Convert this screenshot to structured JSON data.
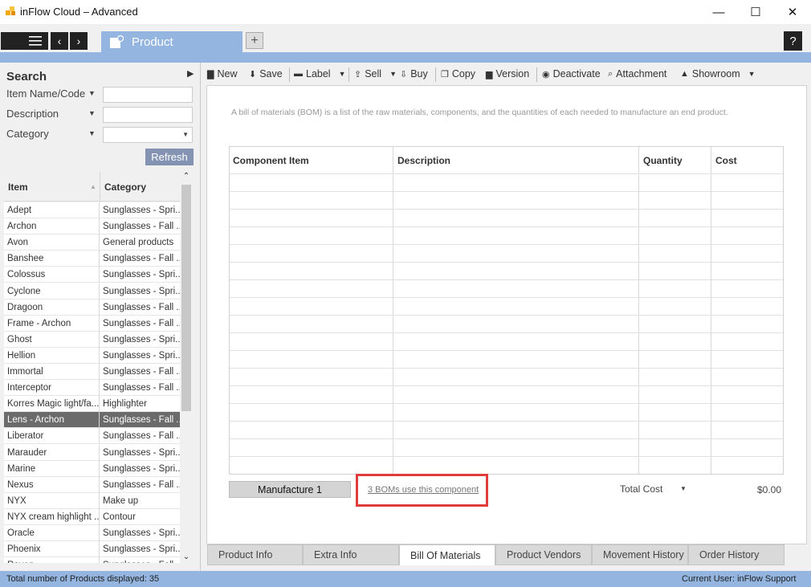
{
  "window": {
    "title": "inFlow Cloud – Advanced",
    "minimize": "—",
    "maximize": "☐",
    "close": "✕"
  },
  "tabs": {
    "product_tab": "Product",
    "add_tab": "+",
    "help": "?"
  },
  "search": {
    "title": "Search",
    "fields": [
      {
        "label": "Item Name/Code",
        "value": ""
      },
      {
        "label": "Description",
        "value": ""
      },
      {
        "label": "Category",
        "value": ""
      }
    ],
    "refresh_label": "Refresh"
  },
  "list": {
    "headers": {
      "item": "Item",
      "category": "Category"
    },
    "rows": [
      {
        "item": "Adept",
        "category": "Sunglasses - Spri..."
      },
      {
        "item": "Archon",
        "category": "Sunglasses - Fall ..."
      },
      {
        "item": "Avon",
        "category": "General products"
      },
      {
        "item": "Banshee",
        "category": "Sunglasses - Fall ..."
      },
      {
        "item": "Colossus",
        "category": "Sunglasses - Spri..."
      },
      {
        "item": "Cyclone",
        "category": "Sunglasses - Spri..."
      },
      {
        "item": "Dragoon",
        "category": "Sunglasses - Fall ..."
      },
      {
        "item": "Frame - Archon",
        "category": "Sunglasses - Fall ..."
      },
      {
        "item": "Ghost",
        "category": "Sunglasses - Spri..."
      },
      {
        "item": "Hellion",
        "category": "Sunglasses - Spri..."
      },
      {
        "item": "Immortal",
        "category": "Sunglasses - Fall ..."
      },
      {
        "item": "Interceptor",
        "category": "Sunglasses - Fall ..."
      },
      {
        "item": "Korres Magic light/fa...",
        "category": "Highlighter"
      },
      {
        "item": "Lens - Archon",
        "category": "Sunglasses - Fall ...",
        "selected": true
      },
      {
        "item": "Liberator",
        "category": "Sunglasses - Fall ..."
      },
      {
        "item": "Marauder",
        "category": "Sunglasses - Spri..."
      },
      {
        "item": "Marine",
        "category": "Sunglasses - Spri..."
      },
      {
        "item": "Nexus",
        "category": "Sunglasses - Fall ..."
      },
      {
        "item": "NYX",
        "category": "Make up"
      },
      {
        "item": "NYX cream highlight ...",
        "category": "Contour"
      },
      {
        "item": "Oracle",
        "category": "Sunglasses - Spri..."
      },
      {
        "item": "Phoenix",
        "category": "Sunglasses - Spri..."
      },
      {
        "item": "Raven",
        "category": "Sunglasses - Fall ..."
      }
    ]
  },
  "toolbar": {
    "new": "New",
    "save": "Save",
    "label": "Label",
    "sell": "Sell",
    "buy": "Buy",
    "copy": "Copy",
    "version": "Version",
    "deactivate": "Deactivate",
    "attachment": "Attachment",
    "showroom": "Showroom"
  },
  "bom": {
    "description": "A bill of materials (BOM) is a list of the raw materials, components, and the quantities of each needed to manufacture an end product.",
    "columns": {
      "component": "Component Item",
      "description": "Description",
      "quantity": "Quantity",
      "cost": "Cost"
    },
    "manufacture_label": "Manufacture 1",
    "boms_link": "3 BOMs use this component",
    "total_cost_label": "Total Cost",
    "total_cost_value": "$0.00"
  },
  "bottom_tabs": [
    "Product Info",
    "Extra Info",
    "Bill Of Materials",
    "Product Vendors",
    "Movement History",
    "Order History"
  ],
  "status": {
    "left": "Total number of Products displayed: 35",
    "right": "Current User:  inFlow Support"
  }
}
